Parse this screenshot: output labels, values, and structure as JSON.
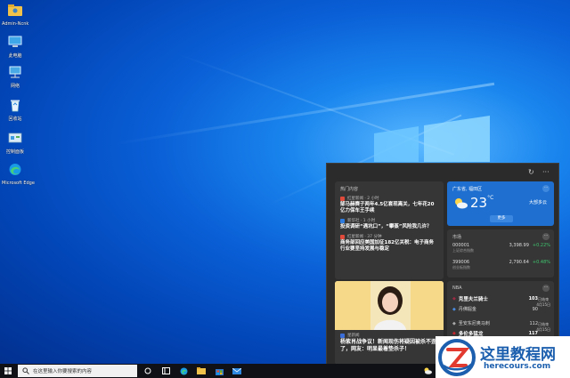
{
  "desktop": {
    "icons": [
      {
        "label": "Admin-Ncnk",
        "icon": "user-folder-icon"
      },
      {
        "label": "此电脑",
        "icon": "this-pc-icon"
      },
      {
        "label": "网络",
        "icon": "network-icon"
      },
      {
        "label": "回收站",
        "icon": "recycle-bin-icon"
      },
      {
        "label": "控制面板",
        "icon": "control-panel-icon"
      },
      {
        "label": "Microsoft Edge",
        "icon": "edge-icon"
      }
    ]
  },
  "panel": {
    "header_icons": [
      "refresh-icon",
      "more-icon"
    ],
    "hot": {
      "title": "热门内容",
      "items": [
        {
          "source": "红星新闻 · 2 小时",
          "title": "郜马赫赛子两年4.5亿套现离关，七年花20亿力保车王手续"
        },
        {
          "source": "新华社 · 1 小时",
          "title": "投资调研“遇坑口”，“攀蒸”风险我几许？"
        },
        {
          "source": "红星新闻 · 37 分钟",
          "title": "商务部回应美国加征182亿关税：电子商务行业要坚持发展与稳定"
        }
      ],
      "image_source": "星新闻",
      "image_title": "杨紫肖战争议！新闻现伤将疑因被杀不歪了，网友：明显最着垫杀子！"
    },
    "weather": {
      "location": "广东省, 福田区",
      "temp": "23",
      "unit": "°C",
      "desc": "大部多云",
      "more": "更多"
    },
    "stocks": {
      "title": "市场",
      "rows": [
        {
          "code": "000001",
          "name": "上证综合指数",
          "value": "3,398.99",
          "change": "+0.22%"
        },
        {
          "code": "399006",
          "name": "创业板指数",
          "value": "2,790.64",
          "change": "+0.48%"
        }
      ]
    },
    "nba": {
      "title": "NBA",
      "games": [
        {
          "team1": "克里夫兰骑士",
          "score1": "103",
          "team2": "丹佛掘金",
          "score2": "90",
          "status": "已结束",
          "date": "4月15日"
        },
        {
          "team1": "圣安东尼奥马刺",
          "score1": "112",
          "team2": "多伦多猛龙",
          "score2": "117",
          "status": "已结束",
          "date": "4月15日"
        }
      ]
    }
  },
  "taskbar": {
    "search_placeholder": "在这里输入你要搜索的内容",
    "icons": [
      "start-icon",
      "search-icon",
      "task-view-icon",
      "widgets-icon",
      "edge-icon",
      "file-explorer-icon",
      "store-icon",
      "mail-icon"
    ]
  },
  "watermark": {
    "title": "这里教程网",
    "url": "herecours.com"
  },
  "colors": {
    "accent": "#0a63d8",
    "panel": "#2b2b2b",
    "weather": "#1e6fd0",
    "green": "#3ec46d"
  }
}
